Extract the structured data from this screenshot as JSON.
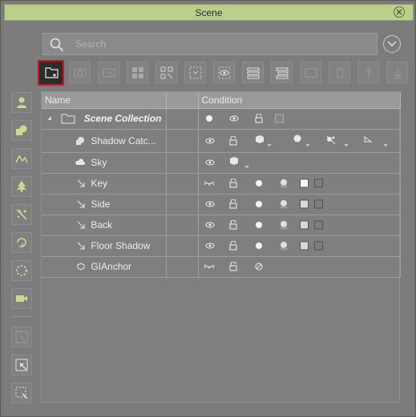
{
  "window": {
    "title": "Scene"
  },
  "search": {
    "placeholder": "Search",
    "value": ""
  },
  "toolbar": {
    "buttons": [
      "new-collection-icon",
      "camera-view-icon",
      "export-icon",
      "grid-icon",
      "group-icon",
      "select-region-icon",
      "visibility-icon",
      "layer-list-icon",
      "layer-stack-icon",
      "ae-icon",
      "delete-icon",
      "move-up-icon",
      "move-down-icon"
    ]
  },
  "sidebar": {
    "buttons": [
      "person-icon",
      "props-icon",
      "terrain-icon",
      "tree-icon",
      "particle-icon",
      "motion-icon",
      "loading-icon",
      "camera-icon",
      "select-icon",
      "pick-icon",
      "marquee-icon"
    ]
  },
  "table": {
    "headers": {
      "name": "Name",
      "blank": "",
      "condition": "Condition"
    },
    "rows": [
      {
        "name": "Scene Collection",
        "type": "collection"
      },
      {
        "name": "Shadow Catc...",
        "type": "shadow-catcher"
      },
      {
        "name": "Sky",
        "type": "sky"
      },
      {
        "name": "Key",
        "type": "light"
      },
      {
        "name": "Side",
        "type": "light"
      },
      {
        "name": "Back",
        "type": "light"
      },
      {
        "name": "Floor Shadow",
        "type": "light"
      },
      {
        "name": "GIAnchor",
        "type": "anchor"
      }
    ]
  },
  "colors": {
    "title_bar": "#b9cf8a",
    "active_button_border": "#c81a1a"
  }
}
